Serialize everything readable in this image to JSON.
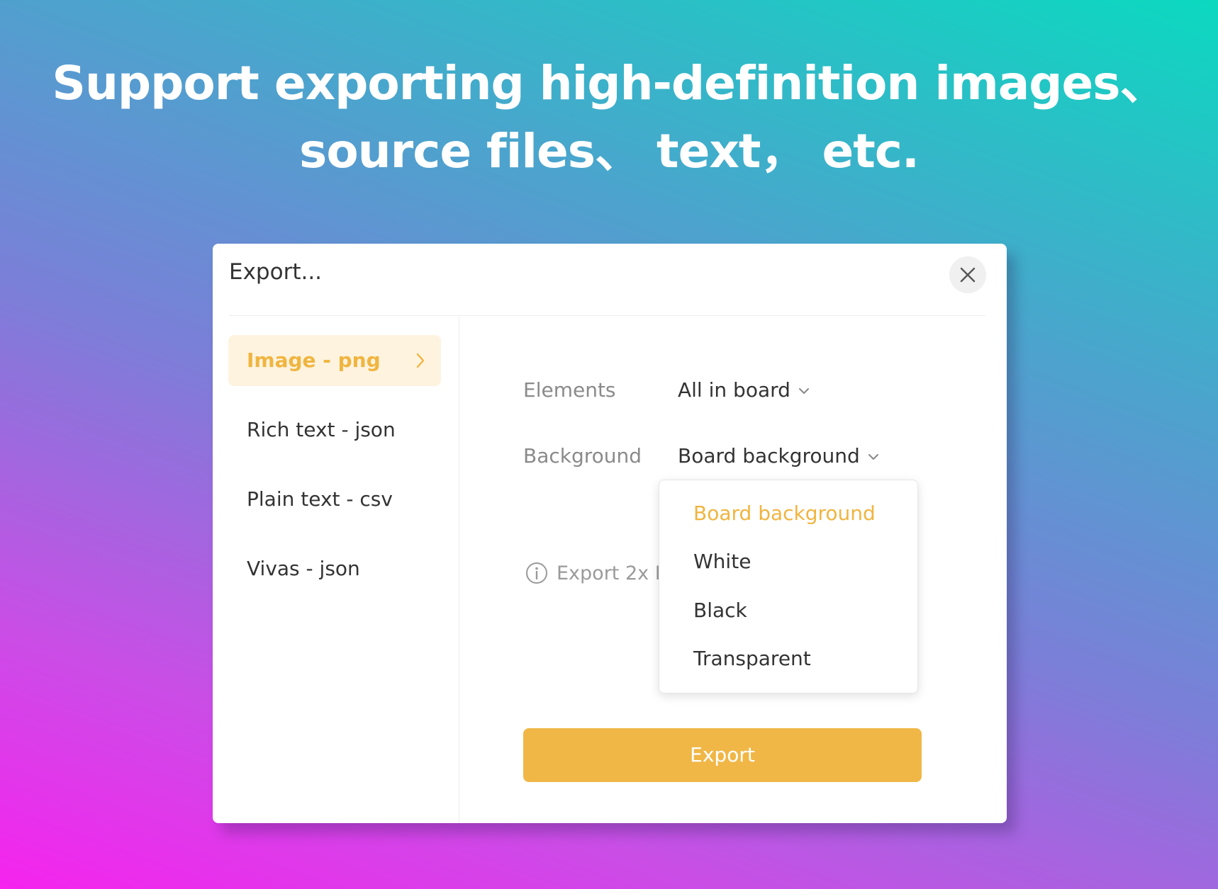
{
  "headline": {
    "line1": "Support exporting high-definition images、",
    "line2": "source files、 text， etc."
  },
  "dialog": {
    "title": "Export...",
    "close_icon": "close-icon"
  },
  "sidebar": {
    "items": [
      {
        "label": "Image - png",
        "active": true
      },
      {
        "label": "Rich text - json",
        "active": false
      },
      {
        "label": "Plain text - csv",
        "active": false
      },
      {
        "label": "Vivas - json",
        "active": false
      }
    ]
  },
  "form": {
    "elements": {
      "label": "Elements",
      "value": "All in board"
    },
    "background": {
      "label": "Background",
      "value": "Board background"
    },
    "hint": "Export 2x H"
  },
  "dropdown": {
    "options": [
      {
        "label": "Board background",
        "selected": true
      },
      {
        "label": "White",
        "selected": false
      },
      {
        "label": "Black",
        "selected": false
      },
      {
        "label": "Transparent",
        "selected": false
      }
    ]
  },
  "export_button": {
    "label": "Export"
  },
  "colors": {
    "accent": "#f0b540",
    "accent_bg": "#fdf3df",
    "button": "#f0b747",
    "text": "#333333",
    "muted": "#8a8a8a"
  }
}
